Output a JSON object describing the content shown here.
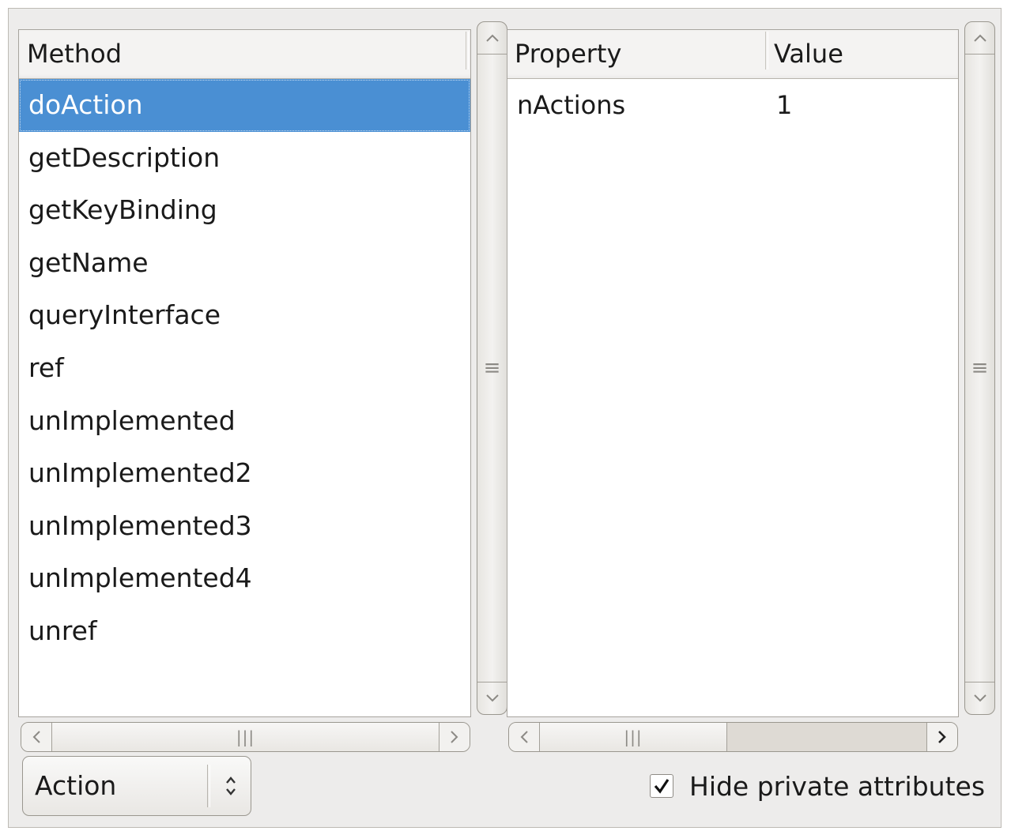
{
  "methods_panel": {
    "column_header": "Method",
    "items": [
      {
        "label": "doAction",
        "selected": true
      },
      {
        "label": "getDescription"
      },
      {
        "label": "getKeyBinding"
      },
      {
        "label": "getName"
      },
      {
        "label": "queryInterface"
      },
      {
        "label": "ref"
      },
      {
        "label": "unImplemented"
      },
      {
        "label": "unImplemented2"
      },
      {
        "label": "unImplemented3"
      },
      {
        "label": "unImplemented4"
      },
      {
        "label": "unref"
      }
    ]
  },
  "properties_panel": {
    "columns": [
      "Property",
      "Value"
    ],
    "rows": [
      {
        "property": "nActions",
        "value": "1"
      }
    ]
  },
  "interface_select": {
    "value": "Action"
  },
  "hide_private": {
    "label": "Hide private attributes",
    "checked": true
  },
  "icons": {
    "scroll_up": "chevron-up-icon",
    "scroll_down": "chevron-down-icon",
    "scroll_left": "chevron-left-icon",
    "scroll_right": "chevron-right-icon",
    "combo": "up-down-arrows-icon",
    "check": "checkmark-icon"
  },
  "colors": {
    "selection": "#4a8fd3",
    "window_bg": "#edeceb"
  }
}
